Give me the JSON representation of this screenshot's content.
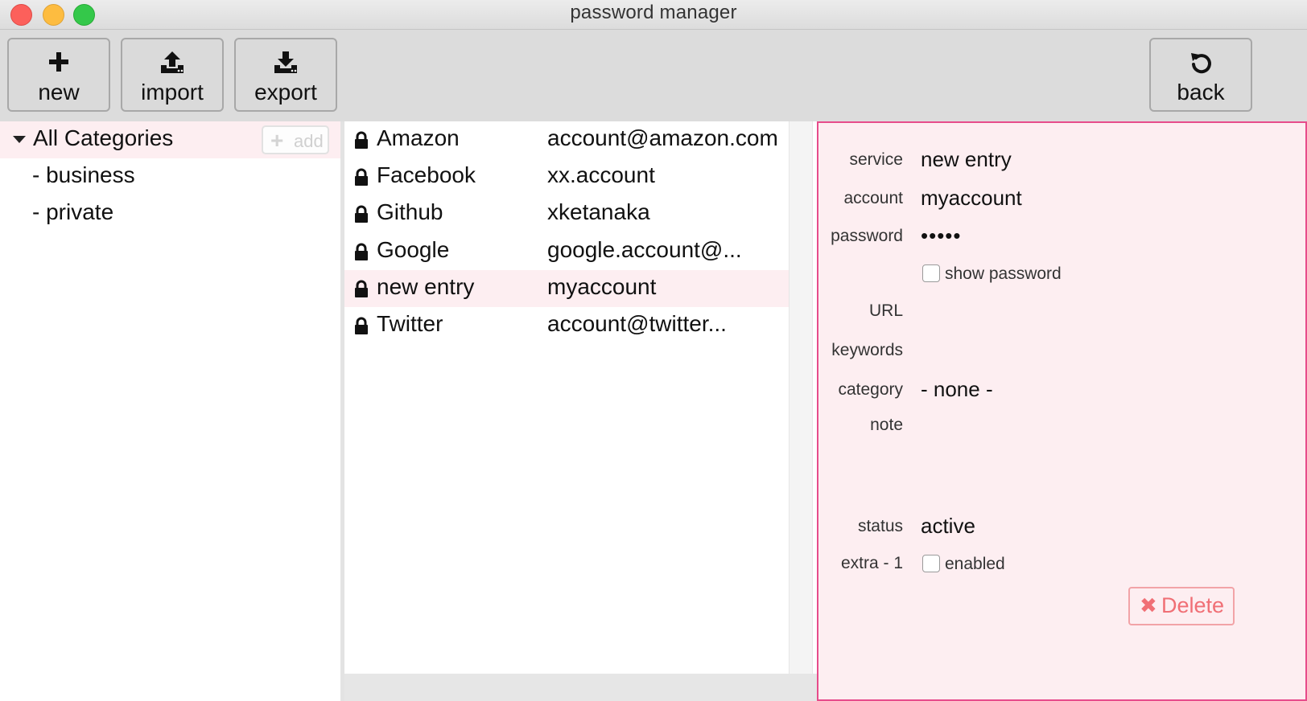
{
  "window": {
    "title": "password manager"
  },
  "colors": {
    "selection": "#fdeef1",
    "accent_border": "#e74c8b",
    "delete": "#f06f75"
  },
  "toolbar": {
    "new_label": "new",
    "new_icon": "plus-icon",
    "import_label": "import",
    "import_icon": "upload-icon",
    "export_label": "export",
    "export_icon": "download-icon",
    "back_label": "back",
    "back_icon": "undo-icon"
  },
  "categories": {
    "title": "All Categories",
    "add_label": "add",
    "items": [
      {
        "label": "- business"
      },
      {
        "label": "- private"
      }
    ]
  },
  "entries": [
    {
      "service": "Amazon",
      "account": "account@amazon.com",
      "selected": false
    },
    {
      "service": "Facebook",
      "account": "xx.account",
      "selected": false
    },
    {
      "service": "Github",
      "account": "xketanaka",
      "selected": false
    },
    {
      "service": "Google",
      "account": "google.account@...",
      "selected": false
    },
    {
      "service": "new entry",
      "account": "myaccount",
      "selected": true
    },
    {
      "service": "Twitter",
      "account": "account@twitter...",
      "selected": false
    }
  ],
  "detail": {
    "service_label": "service",
    "service_value": "new entry",
    "account_label": "account",
    "account_value": "myaccount",
    "password_label": "password",
    "password_value": "•••••",
    "show_password_label": "show password",
    "show_password_checked": false,
    "url_label": "URL",
    "keywords_label": "keywords",
    "category_label": "category",
    "category_value": "- none -",
    "note_label": "note",
    "status_label": "status",
    "status_value": "active",
    "extra1_label": "extra - 1",
    "extra1_check_label": "enabled",
    "extra1_checked": false,
    "delete_label": "Delete"
  }
}
